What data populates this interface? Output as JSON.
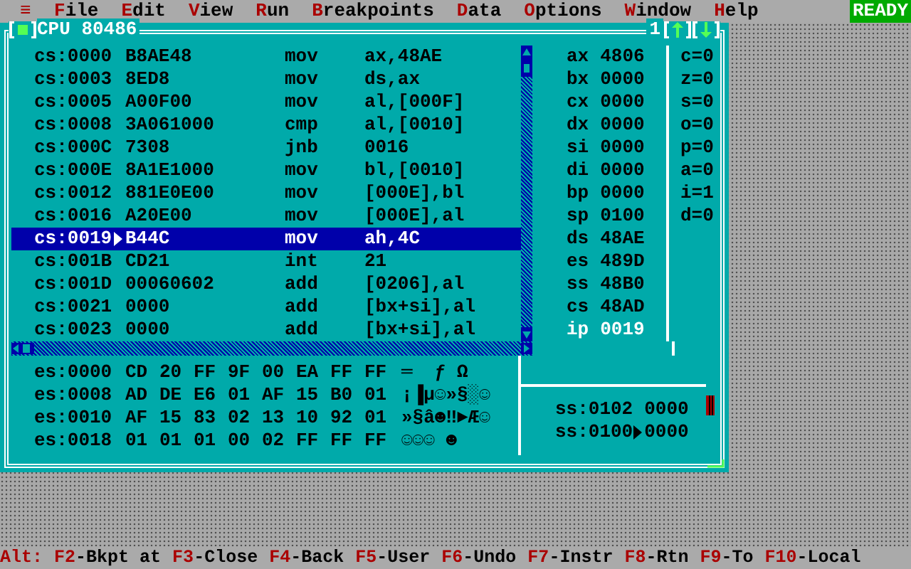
{
  "menu_bar": {
    "system_icon": "≡",
    "items": [
      {
        "hotkey": "F",
        "rest": "ile"
      },
      {
        "hotkey": "E",
        "rest": "dit"
      },
      {
        "hotkey": "V",
        "rest": "iew"
      },
      {
        "hotkey": "R",
        "rest": "un"
      },
      {
        "hotkey": "B",
        "rest": "reakpoints"
      },
      {
        "hotkey": "D",
        "rest": "ata"
      },
      {
        "hotkey": "O",
        "rest": "ptions"
      },
      {
        "hotkey": "W",
        "rest": "indow"
      },
      {
        "hotkey": "H",
        "rest": "elp"
      }
    ],
    "status": "READY"
  },
  "window": {
    "title": "CPU 80486",
    "number": "1",
    "code_rows": [
      {
        "address": "cs:0000",
        "bytes": "B8AE48",
        "mnemonic": "mov",
        "operands": "ax,48AE",
        "selected": false,
        "current": false
      },
      {
        "address": "cs:0003",
        "bytes": "8ED8",
        "mnemonic": "mov",
        "operands": "ds,ax",
        "selected": false,
        "current": false
      },
      {
        "address": "cs:0005",
        "bytes": "A00F00",
        "mnemonic": "mov",
        "operands": "al,[000F]",
        "selected": false,
        "current": false
      },
      {
        "address": "cs:0008",
        "bytes": "3A061000",
        "mnemonic": "cmp",
        "operands": "al,[0010]",
        "selected": false,
        "current": false
      },
      {
        "address": "cs:000C",
        "bytes": "7308",
        "mnemonic": "jnb",
        "operands": "0016",
        "selected": false,
        "current": false
      },
      {
        "address": "cs:000E",
        "bytes": "8A1E1000",
        "mnemonic": "mov",
        "operands": "bl,[0010]",
        "selected": false,
        "current": false
      },
      {
        "address": "cs:0012",
        "bytes": "881E0E00",
        "mnemonic": "mov",
        "operands": "[000E],bl",
        "selected": false,
        "current": false
      },
      {
        "address": "cs:0016",
        "bytes": "A20E00",
        "mnemonic": "mov",
        "operands": "[000E],al",
        "selected": false,
        "current": false
      },
      {
        "address": "cs:0019",
        "bytes": "B44C",
        "mnemonic": "mov",
        "operands": "ah,4C",
        "selected": true,
        "current": true
      },
      {
        "address": "cs:001B",
        "bytes": "CD21",
        "mnemonic": "int",
        "operands": "21",
        "selected": false,
        "current": false
      },
      {
        "address": "cs:001D",
        "bytes": "00060602",
        "mnemonic": "add",
        "operands": "[0206],al",
        "selected": false,
        "current": false
      },
      {
        "address": "cs:0021",
        "bytes": "0000",
        "mnemonic": "add",
        "operands": "[bx+si],al",
        "selected": false,
        "current": false
      },
      {
        "address": "cs:0023",
        "bytes": "0000",
        "mnemonic": "add",
        "operands": "[bx+si],al",
        "selected": false,
        "current": false
      }
    ],
    "registers": [
      {
        "name": "ax",
        "value": "4806",
        "changed": false
      },
      {
        "name": "bx",
        "value": "0000",
        "changed": false
      },
      {
        "name": "cx",
        "value": "0000",
        "changed": false
      },
      {
        "name": "dx",
        "value": "0000",
        "changed": false
      },
      {
        "name": "si",
        "value": "0000",
        "changed": false
      },
      {
        "name": "di",
        "value": "0000",
        "changed": false
      },
      {
        "name": "bp",
        "value": "0000",
        "changed": false
      },
      {
        "name": "sp",
        "value": "0100",
        "changed": false
      },
      {
        "name": "ds",
        "value": "48AE",
        "changed": false
      },
      {
        "name": "es",
        "value": "489D",
        "changed": false
      },
      {
        "name": "ss",
        "value": "48B0",
        "changed": false
      },
      {
        "name": "cs",
        "value": "48AD",
        "changed": false
      },
      {
        "name": "ip",
        "value": "0019",
        "changed": true
      }
    ],
    "flags": [
      "c=0",
      "z=0",
      "s=0",
      "o=0",
      "p=0",
      "a=0",
      "i=1",
      "d=0"
    ],
    "dump_rows": [
      {
        "address": "es:0000",
        "bytes": [
          "CD",
          "20",
          "FF",
          "9F",
          "00",
          "EA",
          "FF",
          "FF"
        ],
        "ascii": "═  ƒ Ω"
      },
      {
        "address": "es:0008",
        "bytes": [
          "AD",
          "DE",
          "E6",
          "01",
          "AF",
          "15",
          "B0",
          "01"
        ],
        "ascii": "¡▐µ☺»§░☺"
      },
      {
        "address": "es:0010",
        "bytes": [
          "AF",
          "15",
          "83",
          "02",
          "13",
          "10",
          "92",
          "01"
        ],
        "ascii": "»§â☻‼►Æ☺"
      },
      {
        "address": "es:0018",
        "bytes": [
          "01",
          "01",
          "01",
          "00",
          "02",
          "FF",
          "FF",
          "FF"
        ],
        "ascii": "☺☺☺ ☻"
      }
    ],
    "stack_rows": [
      {
        "address": "ss:0102",
        "value": "0000",
        "current": false
      },
      {
        "address": "ss:0100",
        "value": "0000",
        "current": true
      }
    ]
  },
  "status_bar": {
    "prefix": "Alt:",
    "keys": [
      {
        "key": "F2",
        "label": "-Bkpt at"
      },
      {
        "key": "F3",
        "label": "-Close"
      },
      {
        "key": "F4",
        "label": "-Back"
      },
      {
        "key": "F5",
        "label": "-User"
      },
      {
        "key": "F6",
        "label": "-Undo"
      },
      {
        "key": "F7",
        "label": "-Instr"
      },
      {
        "key": "F8",
        "label": "-Rtn"
      },
      {
        "key": "F9",
        "label": "-To"
      },
      {
        "key": "F10",
        "label": "-Local"
      }
    ]
  }
}
